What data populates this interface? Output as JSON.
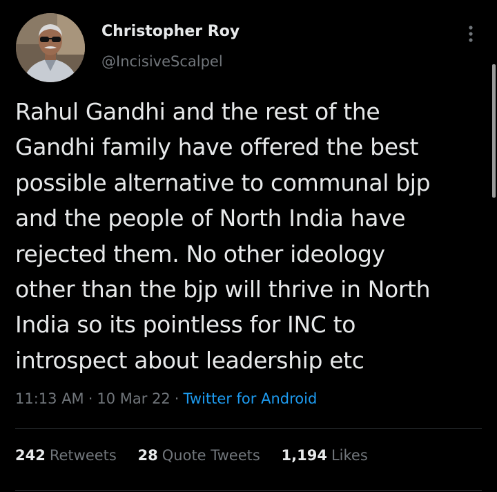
{
  "author": {
    "name": "Christopher Roy",
    "handle": "@IncisiveScalpel"
  },
  "tweet": {
    "text": "Rahul Gandhi and the rest of the\nGandhi family have offered the best\npossible alternative to communal bjp\nand the people of North India have\nrejected them. No other ideology\nother than the bjp will thrive in North\nIndia so its pointless for INC to\nintrospect about leadership etc",
    "time": "11:13 AM",
    "separator": "·",
    "date": "10 Mar 22",
    "source": "Twitter for Android"
  },
  "stats": {
    "retweets_count": "242",
    "retweets_label": "Retweets",
    "quote_tweets_count": "28",
    "quote_tweets_label": "Quote Tweets",
    "likes_count": "1,194",
    "likes_label": "Likes"
  },
  "icons": {
    "more": "more-vertical-icon",
    "avatar": "profile-avatar"
  },
  "colors": {
    "background": "#000000",
    "primary_text": "#e7e9ea",
    "secondary_text": "#71767b",
    "link": "#1d9bf0",
    "divider": "#2f3336"
  }
}
